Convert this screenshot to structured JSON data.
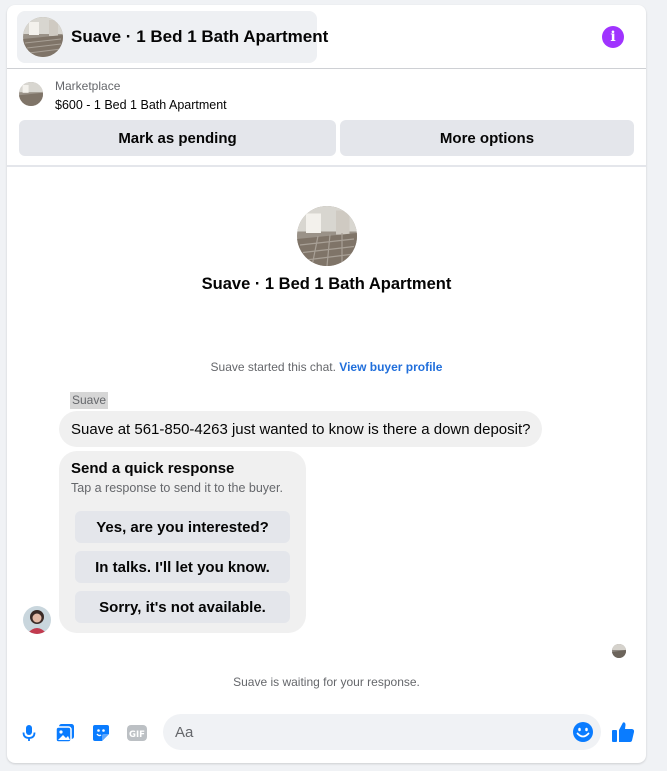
{
  "conversation": {
    "title": "Suave · 1 Bed 1 Bath Apartment"
  },
  "marketplace": {
    "label": "Marketplace",
    "listing": "$600 - 1 Bed 1 Bath Apartment",
    "mark_pending_label": "Mark as pending",
    "more_options_label": "More options"
  },
  "chat": {
    "name": "Suave · 1 Bed 1 Bath Apartment",
    "started_text": "Suave started this chat.",
    "view_profile_label": "View buyer profile",
    "sender_name": "Suave",
    "message": "Suave at 561-850-4263 just wanted to know is there a down deposit?",
    "quick_response": {
      "title": "Send a quick response",
      "subtitle": "Tap a response to send it to the buyer.",
      "options": [
        "Yes, are you interested?",
        "In talks. I'll let you know.",
        "Sorry, it's not available."
      ]
    },
    "waiting_text": "Suave is waiting for your response."
  },
  "composer": {
    "placeholder": "Aa"
  },
  "colors": {
    "accent": "#0a7cff",
    "info": "#a033ff",
    "bubble": "#f0f0f0"
  }
}
